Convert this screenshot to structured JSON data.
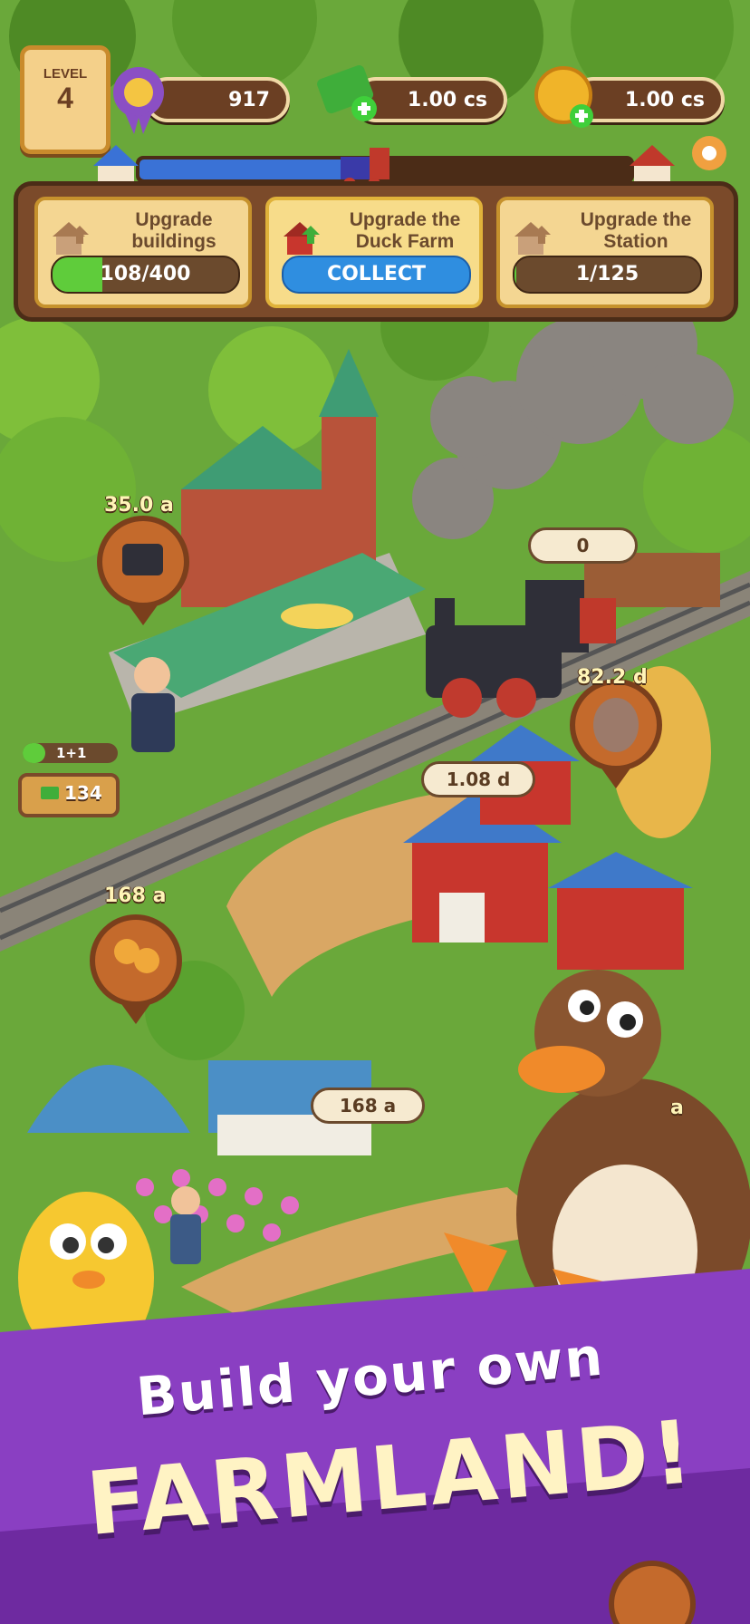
{
  "hud": {
    "level_label": "LEVEL",
    "level_value": "4",
    "xp_value": "917",
    "cash_value": "1.00 cs",
    "coins_value": "1.00 cs"
  },
  "quests": [
    {
      "title": "Upgrade buildings",
      "progress": "108/400",
      "progress_fraction": 0.27
    },
    {
      "title": "Upgrade the Duck Farm",
      "button": "COLLECT"
    },
    {
      "title": "Upgrade the Station",
      "progress": "1/125",
      "progress_fraction": 0.008
    }
  ],
  "map": {
    "station_timer": "35.0 a",
    "train_bubble": "0",
    "donkey_timer": "82.2 d",
    "barn_bubble": "1.08 d",
    "honey_timer": "168 a",
    "bee_bubble": "168 a",
    "worker_ratio": "1+1",
    "station_cash": "134",
    "right_edge_label": "a"
  },
  "banner": {
    "line1": "Build your own",
    "line2": "FARMLAND!"
  },
  "colors": {
    "banner": "#8a3fc2",
    "grass": "#5f9a2f",
    "wood": "#7b4a2a"
  }
}
